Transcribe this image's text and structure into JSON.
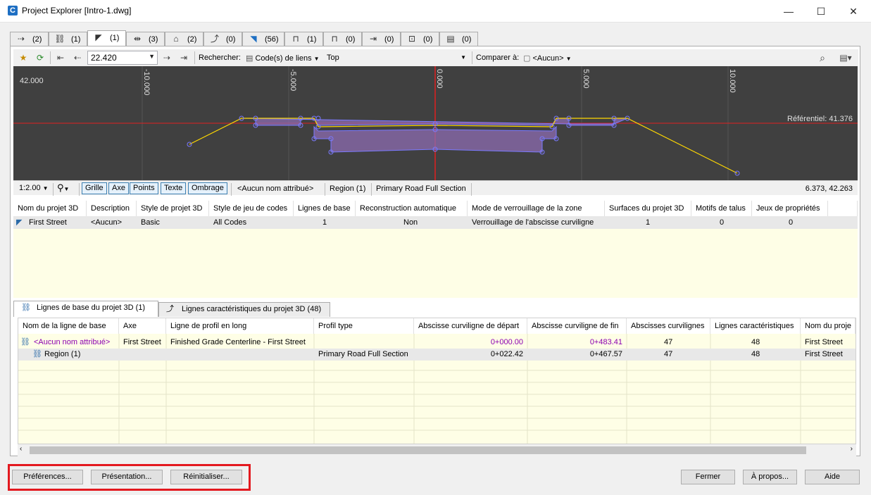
{
  "window": {
    "title": "Project Explorer [Intro-1.dwg]",
    "app_icon": "C",
    "min": "—",
    "max": "☐",
    "close": "✕"
  },
  "tabs": [
    {
      "icon": "alignment-icon",
      "glyph": "⇢",
      "count": "(2)"
    },
    {
      "icon": "profile-view-icon",
      "glyph": "⛓",
      "count": "(1)"
    },
    {
      "icon": "corridor-icon",
      "glyph": "◤",
      "count": "(1)"
    },
    {
      "icon": "sample-line-icon",
      "glyph": "⇹",
      "count": "(3)"
    },
    {
      "icon": "surface-icon",
      "glyph": "⌂",
      "count": "(2)"
    },
    {
      "icon": "feature-line-icon",
      "glyph": "⤴",
      "count": "(0)"
    },
    {
      "icon": "pipe-network-icon",
      "glyph": "◥",
      "count": "(56)"
    },
    {
      "icon": "structure-icon",
      "glyph": "⊓",
      "count": "(1)"
    },
    {
      "icon": "bridge-icon",
      "glyph": "⊓",
      "count": "(0)"
    },
    {
      "icon": "section-icon",
      "glyph": "⇥",
      "count": "(0)"
    },
    {
      "icon": "parcel-icon",
      "glyph": "⊡",
      "count": "(0)"
    },
    {
      "icon": "property-set-icon",
      "glyph": "▤",
      "count": "(0)"
    }
  ],
  "toolbar": {
    "station": "22.420",
    "search_label": "Rechercher:",
    "code_type": "Code(s) de liens",
    "code_value": "Top",
    "compare_label": "Comparer à:",
    "compare_value": "<Aucun>"
  },
  "viewer": {
    "y_label": "42.000",
    "x_ticks": [
      "-10.000",
      "-5.000",
      "0.000",
      "5.000",
      "10.000"
    ],
    "datum_label": "Référentiel: 41.376"
  },
  "viewer_status": {
    "scale": "1:2.00",
    "toggles": [
      "Grille",
      "Axe",
      "Points",
      "Texte",
      "Ombrage"
    ],
    "name": "<Aucun nom attribué>",
    "region": "Region (1)",
    "assembly": "Primary Road Full Section",
    "coords": "6.373, 42.263"
  },
  "grid1": {
    "headers": [
      "Nom du projet 3D",
      "Description",
      "Style de projet 3D",
      "Style de jeu de codes",
      "Lignes de base",
      "Reconstruction automatique",
      "Mode de verrouillage de la zone",
      "Surfaces du projet 3D",
      "Motifs de talus",
      "Jeux de propriétés"
    ],
    "row": [
      "First Street",
      "<Aucun>",
      "Basic",
      "All Codes",
      "1",
      "Non",
      "Verrouillage de l'abscisse curviligne",
      "1",
      "0",
      "0"
    ]
  },
  "subtabs": [
    "Lignes de base du projet 3D (1)",
    "Lignes caractéristiques du projet 3D (48)"
  ],
  "grid2": {
    "headers": [
      "Nom de la ligne de base",
      "Axe",
      "Ligne de profil en long",
      "Profil type",
      "Abscisse curviligne de départ",
      "Abscisse curviligne de fin",
      "Abscisses curvilignes",
      "Lignes caractéristiques",
      "Nom du proje"
    ],
    "rows": [
      [
        "<Aucun nom attribué>",
        "First Street",
        "Finished Grade Centerline - First Street",
        "",
        "0+000.00",
        "0+483.41",
        "47",
        "48",
        "First Street"
      ],
      [
        "Region (1)",
        "",
        "",
        "Primary Road Full Section",
        "0+022.42",
        "0+467.57",
        "47",
        "48",
        "First Street"
      ]
    ]
  },
  "buttons": {
    "prefs": "Préférences...",
    "presentation": "Présentation...",
    "reset": "Réinitialiser...",
    "close": "Fermer",
    "about": "À propos...",
    "help": "Aide"
  },
  "colors": {
    "datum": "#e02020",
    "link": "#ffd800",
    "shape_fill": "#8c6bb0",
    "point": "#7a7aff",
    "highlight": "#e3191f",
    "purple_text": "#8b00b0"
  }
}
